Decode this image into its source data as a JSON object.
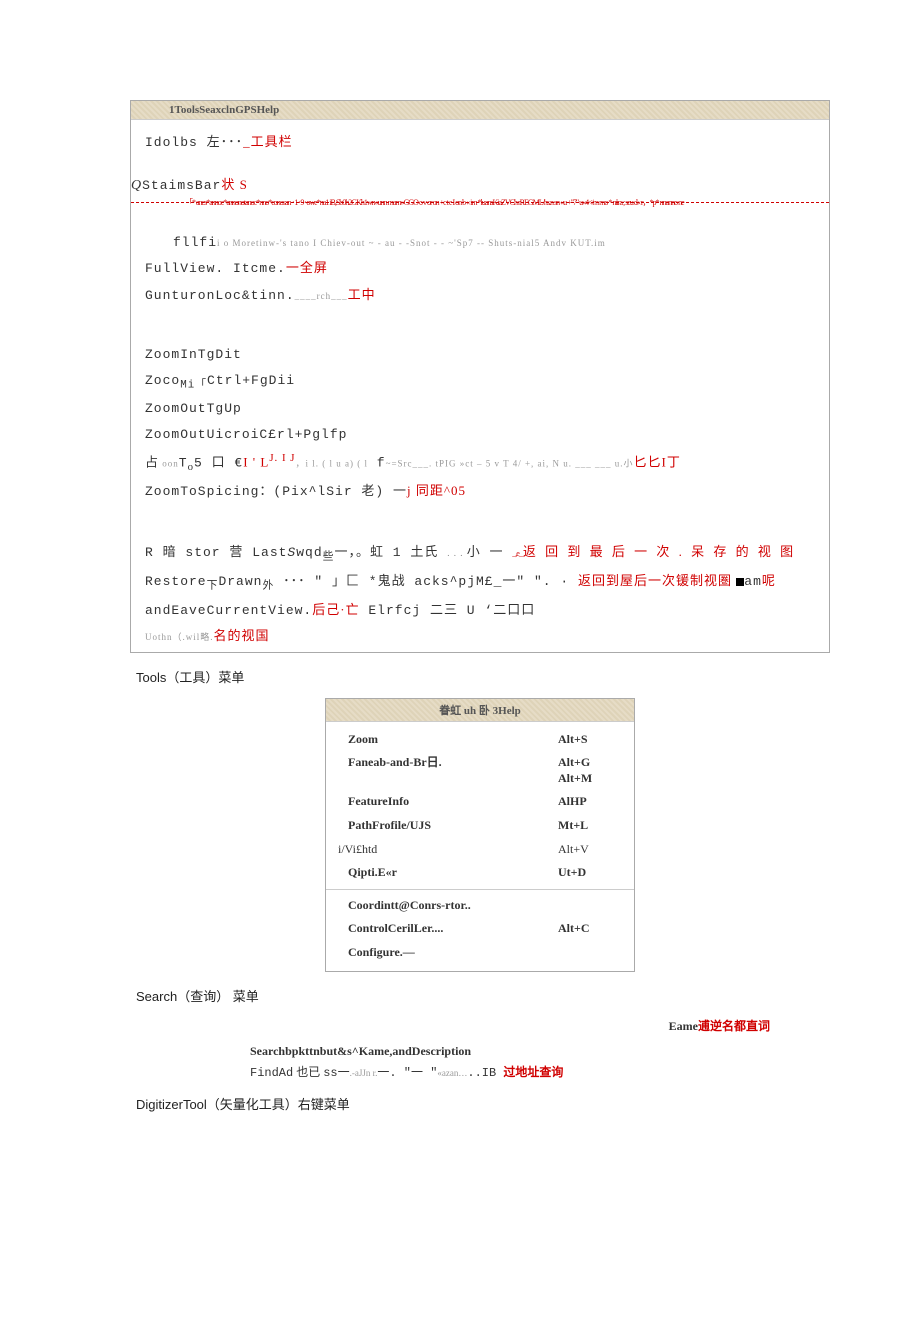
{
  "box1": {
    "header": "1ToolsSeaxclnGPSHelp",
    "l1a": "Idolbs 左･･･",
    "l1b": "_工具栏",
    "l2a": "StaimsBar",
    "l2b": "状 S",
    "rule_art": "「* anes*annoc*annonotanoc*nno*conosan ･1･9･owe*na1 iB,Sb0h2GKh1wn«unn mam»GGO o v or on +c t e I on b « im *luansKiaZVCh rREGML/hs.n sn «u +\"7\" u«4</m mo * niira ; seu d« r，*p* nnanno ne",
    "l3a": "fllfi",
    "l3g": "i o   Moretinw-'s tano I Chiev-out ~ - au - -Snot - - ~'Sp7 -- Shuts-nial5 Andv  KUT.im",
    "l4a": "FullView. Itcme.",
    "l4b": "一全屏",
    "l5a": "GunturonLoc&tinn.",
    "l5g": "____rch___",
    "l5b": "工中",
    "zoom1": "ZoomInTgDit",
    "zoom2a": "Zoco",
    "zoom2b": "Mi",
    "zoom2c": "Ctrl+FgDii",
    "zoom3": "ZoomOutTgUp",
    "zoom4": "ZoomOutUicroiC£rl+Pglfp",
    "l6a": "占",
    "l6g1": " oon",
    "l6b": "T",
    "l6bs": "o",
    "l6c": "5 口 €",
    "l6r1": "I ' L",
    "l6sup": "J. I J",
    "l6g2": "，i l. ( l u a) ( l",
    "l6d": "  f",
    "l6g3": "~=Src___. tPIG »ct – 5 v T 4/ +, ai, N u. ___ ___ u.小",
    "l6r2": "匕匕I丁",
    "l7a": "ZoomToSpicing：(Pix^lSir 老) 一",
    "l7b": "j 同距^05",
    "restore1a": "R 暗 stor 营 Last",
    "restore1it": "S",
    "restore1b": "wqd",
    "restore1sub": "些",
    "restore1c": "一，。虹 1 土氏 ",
    "restore1dots": ". . . ",
    "restore1d": "小 一 ",
    "restore1sq": "_,e_ ",
    "restore1r": "返 回 到 最 后 一 次 . 呆 存 的 视 图",
    "restore2a": "Restore",
    "restore2sub": "下",
    "restore2b": "Drawn",
    "restore2sub2": "外",
    "restore2c": "  ･･･ \" 」匚 *鬼战 acks^pjM£_一\" \". · ",
    "restore2r": "返回到屋后一次锾制视圏 ",
    "restore2am": "am",
    "restore2e": "呢",
    "restore3a": "andEaveCurrentView.",
    "restore3b": "后己·亡",
    "restore3c": " Elrfcj 二三 U ‘二口口",
    "restore4g": "Uothn（.wil略.",
    "restore4r": "名的视国"
  },
  "section_tools": "Tools（工具）菜单",
  "tools": {
    "header": "眷虹 uh 卧 3Help",
    "rows": [
      {
        "lbl": "Zoom",
        "sc": "Alt+S",
        "bold": true
      },
      {
        "lbl": "Faneab-and-Br日.",
        "sc": "Alt+G\nAlt+M",
        "bold": true
      },
      {
        "lbl": "FeatureInfo",
        "sc": "AlHP",
        "bold": true
      },
      {
        "lbl": "PathFrofile/UJS",
        "sc": "Mt+L",
        "bold": true
      },
      {
        "lbl": "i/Vi£htd",
        "sc": "Alt+V",
        "bold": false,
        "noindent": true
      },
      {
        "lbl": "Qipti.E«r",
        "sc": "Ut+D",
        "bold": true
      }
    ],
    "rows2": [
      {
        "lbl": "Coordintt@Conrs-rtor..",
        "sc": "",
        "bold": true
      },
      {
        "lbl": "ControlCerilLer....",
        "sc": "Alt+C",
        "bold": true
      },
      {
        "lbl": "Configure.—",
        "sc": "",
        "bold": true
      }
    ]
  },
  "section_search": "Search（查询） 菜单",
  "search": {
    "right_k": "Eame",
    "right_r": "逋逆名都直词",
    "bold_line": "Searchbpkttnbut&s^Kame,andDescription",
    "f1a": "FindAd",
    "f1b": " 也已 ",
    "f1c": "ss一",
    "f1g": ".-aJJn r.",
    "f1d": "一.  \"一 \"",
    "f1g2": "«azan…",
    "f1e": "..IB  ",
    "f1r": "过地址查询"
  },
  "section_digit": "DigitizerTool（矢量化工具）右键菜单"
}
